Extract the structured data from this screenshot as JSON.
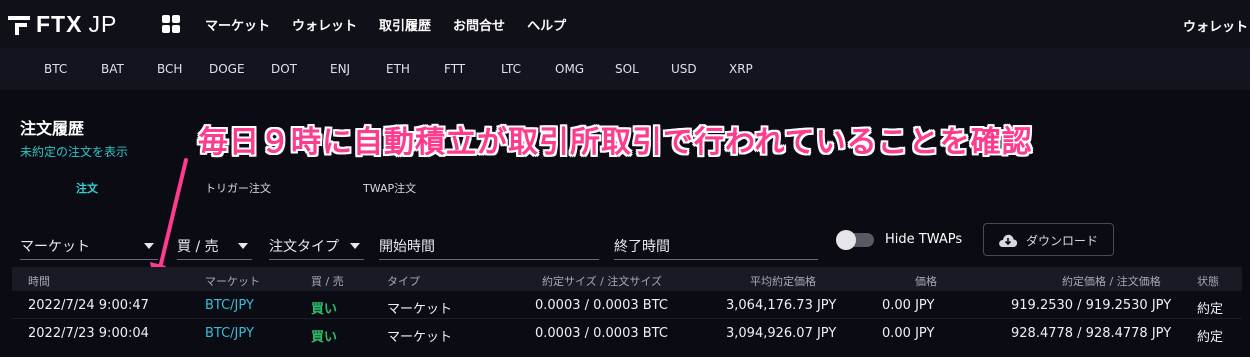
{
  "brand": {
    "name": "FTX",
    "suffix": "JP"
  },
  "nav": {
    "links": [
      "マーケット",
      "ウォレット",
      "取引履歴",
      "お問合せ",
      "ヘルプ"
    ],
    "right": "ウォレット"
  },
  "coins": [
    "BTC",
    "BAT",
    "BCH",
    "DOGE",
    "DOT",
    "ENJ",
    "ETH",
    "FTT",
    "LTC",
    "OMG",
    "SOL",
    "USD",
    "XRP"
  ],
  "page": {
    "title": "注文履歴",
    "show_open_link": "未約定の注文を表示",
    "tabs": [
      "注文",
      "トリガー注文",
      "TWAP注文"
    ]
  },
  "annotation": "毎日９時に自動積立が取引所取引で行われていることを確認",
  "filters": {
    "market": "マーケット",
    "side": "買 / 売",
    "order_type": "注文タイプ",
    "start_time": "開始時間",
    "end_time": "終了時間",
    "hide_twaps": "Hide TWAPs",
    "download": "ダウンロード"
  },
  "table": {
    "headers": [
      "時間",
      "マーケット",
      "買 / 売",
      "タイプ",
      "約定サイズ / 注文サイズ",
      "平均約定価格",
      "価格",
      "約定価格 / 注文価格",
      "状態"
    ],
    "rows": [
      {
        "time": "2022/7/24 9:00:47",
        "market": "BTC/JPY",
        "side": "買い",
        "type": "マーケット",
        "size": "0.0003 / 0.0003 BTC",
        "avg_price": "3,064,176.73 JPY",
        "price": "0.00 JPY",
        "fill_price": "919.2530 / 919.2530 JPY",
        "status": "約定"
      },
      {
        "time": "2022/7/23 9:00:04",
        "market": "BTC/JPY",
        "side": "買い",
        "type": "マーケット",
        "size": "0.0003 / 0.0003 BTC",
        "avg_price": "3,094,926.07 JPY",
        "price": "0.00 JPY",
        "fill_price": "928.4778 / 928.4778 JPY",
        "status": "約定"
      }
    ]
  },
  "colors": {
    "accent": "#39d1d1",
    "buy": "#2ebd6a",
    "annotation": "#ff3b8d"
  }
}
